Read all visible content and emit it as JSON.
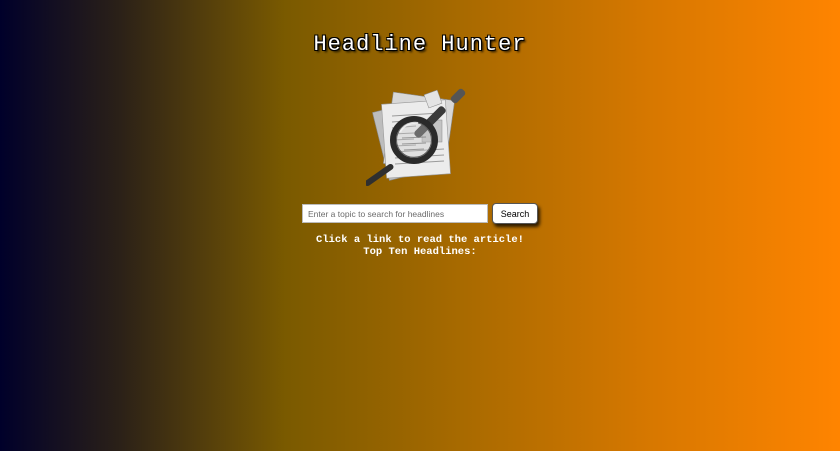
{
  "header": {
    "title": "Headline Hunter"
  },
  "logo": {
    "icon": "newspaper-magnifier-icon"
  },
  "search": {
    "placeholder": "Enter a topic to search for headlines",
    "value": "",
    "button_label": "Search"
  },
  "main": {
    "instructions": "Click a link to read the article!",
    "headlines_heading": "Top Ten Headlines:",
    "headlines": []
  },
  "colors": {
    "gradient_start": "#00002a",
    "gradient_end": "#ff8400",
    "text": "#ffffff"
  }
}
